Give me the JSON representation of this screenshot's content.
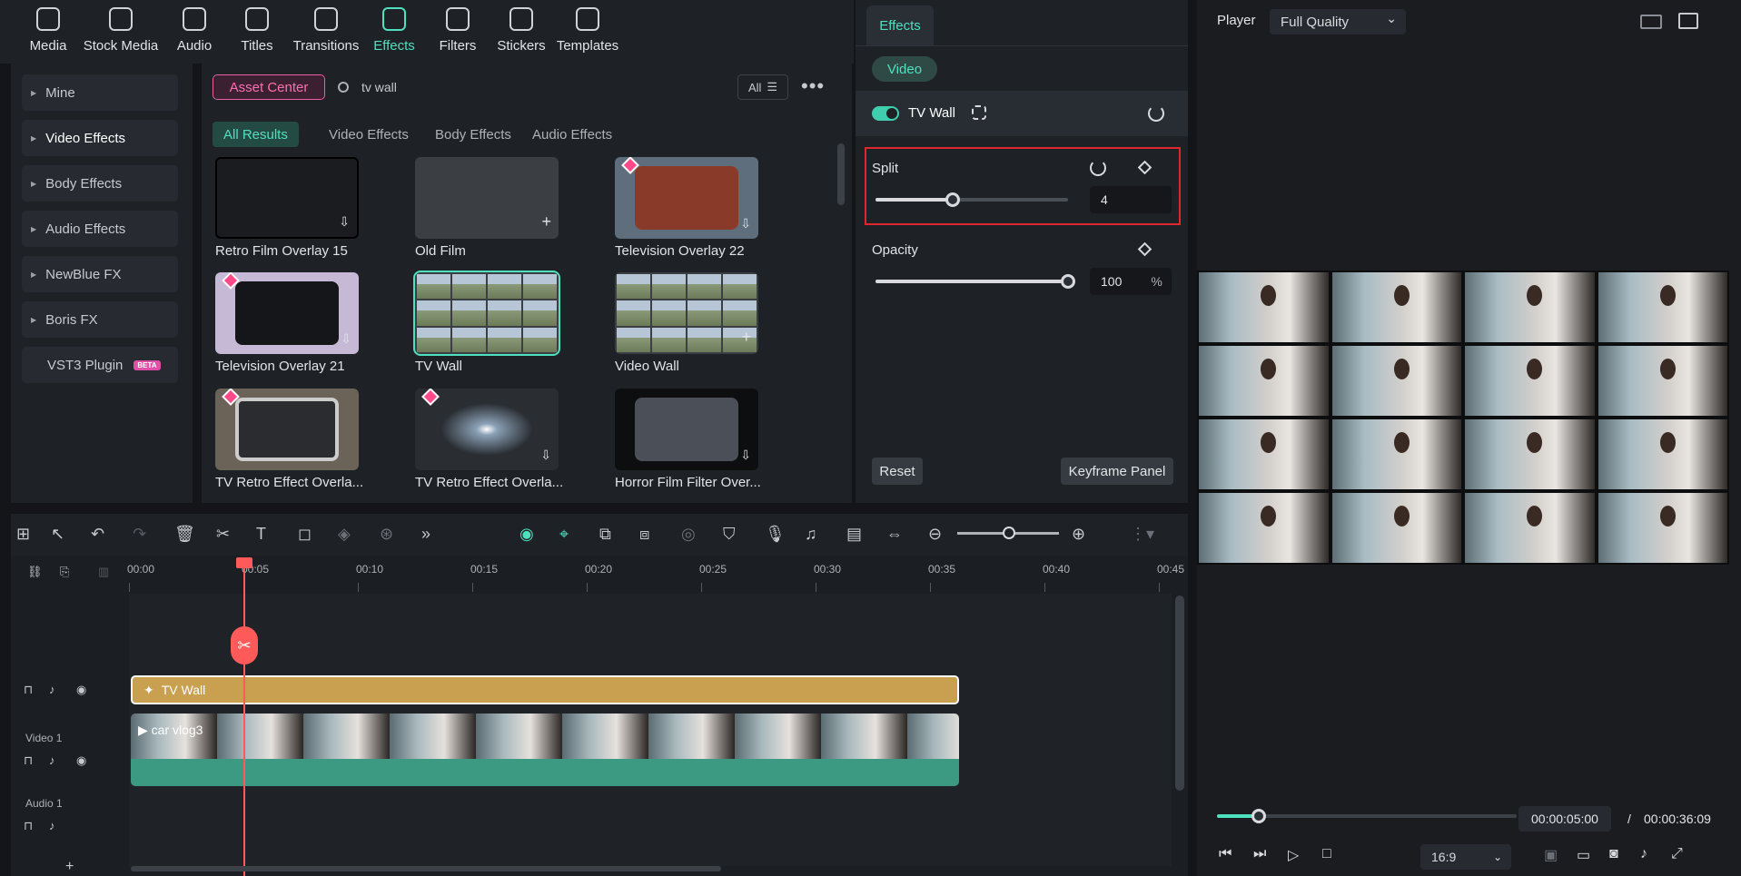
{
  "toolbar": {
    "items": [
      {
        "label": "Media",
        "icon": "media-icon"
      },
      {
        "label": "Stock Media",
        "icon": "stock-media-icon"
      },
      {
        "label": "Audio",
        "icon": "audio-icon"
      },
      {
        "label": "Titles",
        "icon": "titles-icon"
      },
      {
        "label": "Transitions",
        "icon": "transitions-icon"
      },
      {
        "label": "Effects",
        "icon": "effects-icon"
      },
      {
        "label": "Filters",
        "icon": "filters-icon"
      },
      {
        "label": "Stickers",
        "icon": "stickers-icon"
      },
      {
        "label": "Templates",
        "icon": "templates-icon"
      }
    ],
    "active": "Effects"
  },
  "sidebar": {
    "items": [
      {
        "label": "Mine"
      },
      {
        "label": "Video Effects"
      },
      {
        "label": "Body Effects"
      },
      {
        "label": "Audio Effects"
      },
      {
        "label": "NewBlue FX"
      },
      {
        "label": "Boris FX"
      },
      {
        "label": "VST3 Plugin",
        "badge": "BETA"
      }
    ]
  },
  "library": {
    "asset_center": "Asset Center",
    "search_value": "tv wall",
    "all_filter": "All",
    "filters": [
      "All Results",
      "Video Effects",
      "Body Effects",
      "Audio Effects"
    ],
    "items": [
      {
        "label": "Retro Film Overlay 15"
      },
      {
        "label": "Old Film"
      },
      {
        "label": "Television Overlay 22"
      },
      {
        "label": "Television Overlay 21"
      },
      {
        "label": "TV Wall"
      },
      {
        "label": "Video Wall"
      },
      {
        "label": "TV Retro Effect Overla..."
      },
      {
        "label": "TV Retro Effect Overla..."
      },
      {
        "label": "Horror Film Filter Over..."
      }
    ]
  },
  "effects_panel": {
    "tab": "Effects",
    "subtab": "Video",
    "effect_name": "TV Wall",
    "split_label": "Split",
    "split_value": "4",
    "split_level": 0.4,
    "opacity_label": "Opacity",
    "opacity_value": "100",
    "opacity_unit": "%",
    "opacity_level": 1.0,
    "reset": "Reset",
    "keyframe_panel": "Keyframe Panel",
    "highlight_color": "#e0262e"
  },
  "player": {
    "label": "Player",
    "quality": "Full Quality",
    "current_time": "00:00:05:00",
    "separator": "/",
    "total_time": "00:00:36:09",
    "ratio": "16:9",
    "progress": 0.14
  },
  "timeline": {
    "ticks": [
      "00:00",
      "00:05",
      "00:10",
      "00:15",
      "00:20",
      "00:25",
      "00:30",
      "00:35",
      "00:40",
      "00:45"
    ],
    "effect_clip": "TV Wall",
    "video_clip": "car vlog3",
    "track_video": "Video 1",
    "track_audio": "Audio 1",
    "add_track": "+"
  },
  "colors": {
    "accent": "#4fe0c0",
    "playhead": "#ff5a5a",
    "effect_clip": "#c9a050",
    "audio_wave": "#3d9a82"
  }
}
